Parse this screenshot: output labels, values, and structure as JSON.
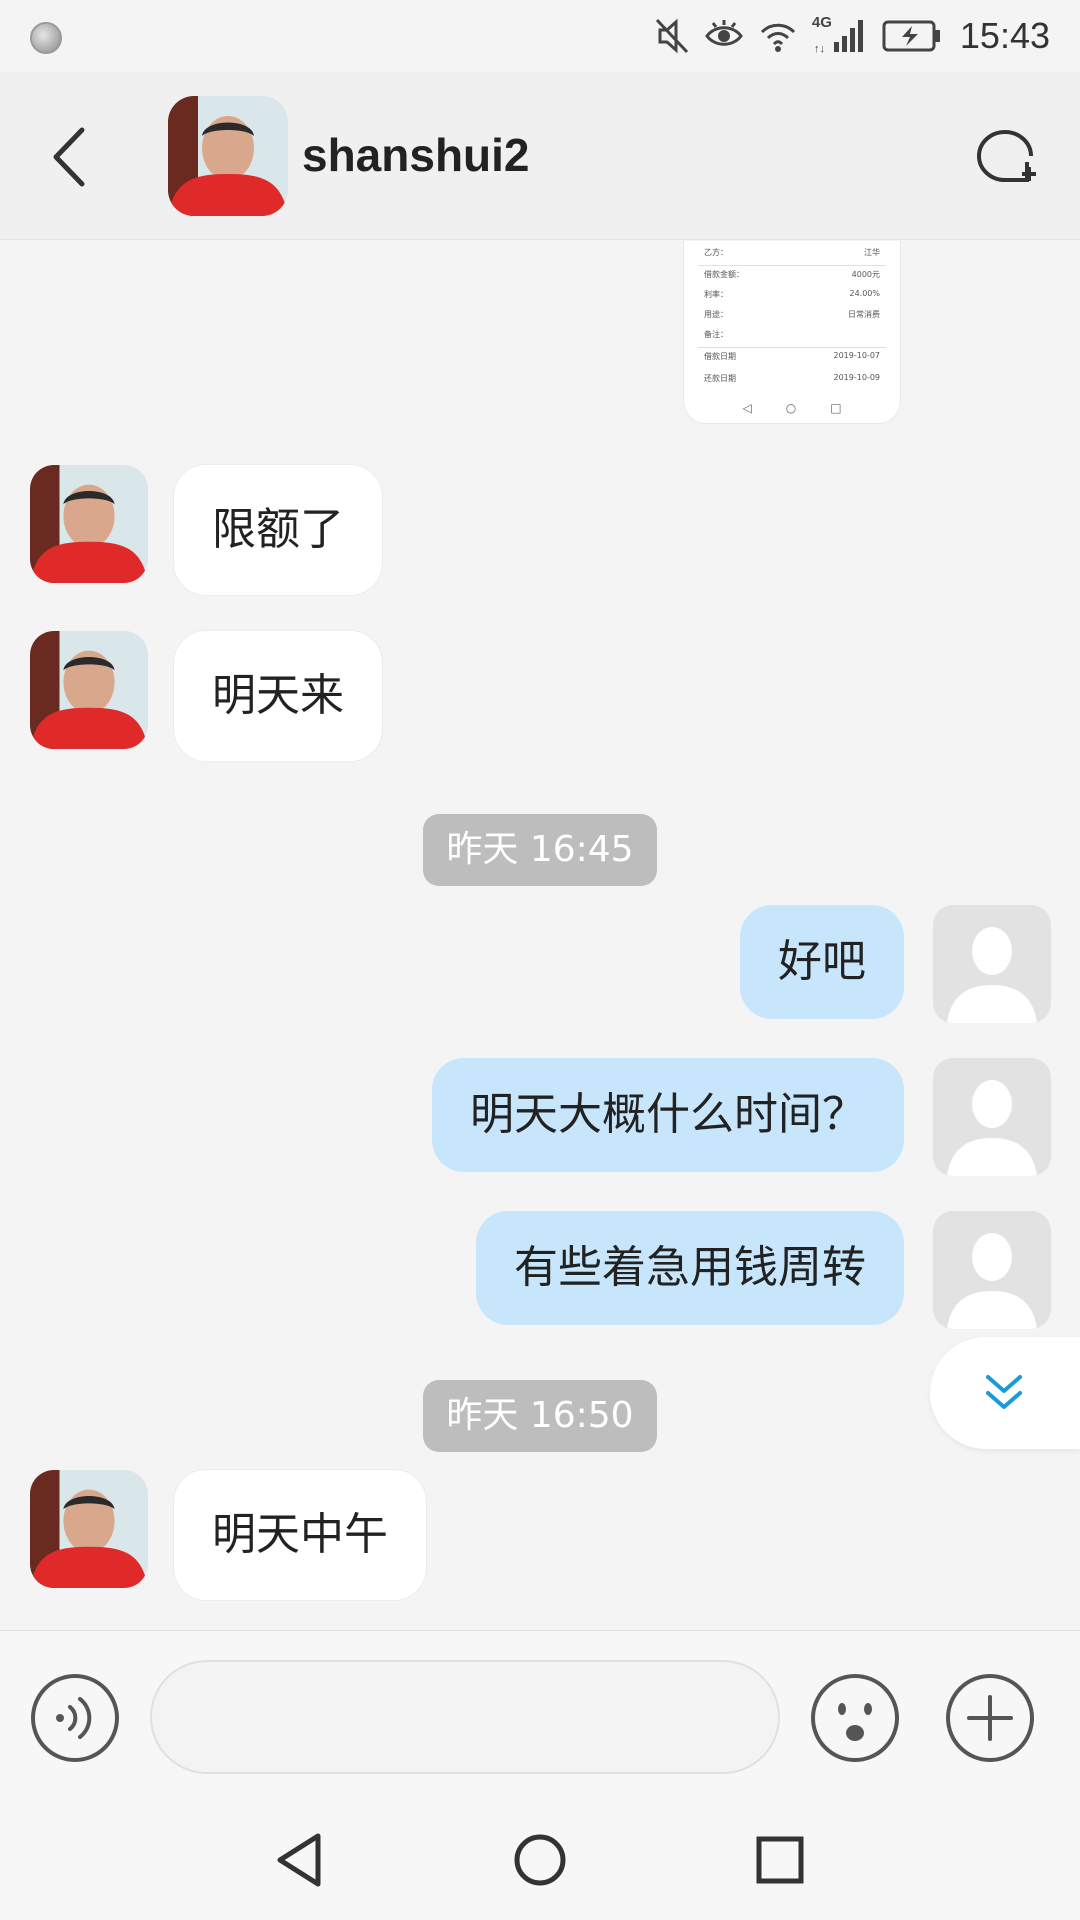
{
  "status_bar": {
    "time": "15:43",
    "network_label": "4G",
    "icons": [
      "notification-app-icon",
      "mute-icon",
      "eye-comfort-icon",
      "wifi-icon",
      "signal-icon",
      "battery-charging-icon"
    ]
  },
  "header": {
    "title": "shanshui2",
    "back_icon": "chevron-left-icon",
    "action_icon": "new-chat-icon"
  },
  "screenshot_message": {
    "rows": [
      {
        "label": "乙方：",
        "value": "江华"
      },
      {
        "label": "借款金额：",
        "value": "4000元"
      },
      {
        "label": "利率：",
        "value": "24.00%"
      },
      {
        "label": "用途：",
        "value": "日常消费"
      },
      {
        "label": "备注：",
        "value": ""
      },
      {
        "label": "借款日期",
        "value": "2019-10-07"
      },
      {
        "label": "还款日期",
        "value": "2019-10-09"
      }
    ],
    "nav_glyphs": [
      "◁",
      "○",
      "□"
    ]
  },
  "messages": [
    {
      "side": "left",
      "text": "限额了"
    },
    {
      "side": "left",
      "text": "明天来"
    },
    {
      "type": "time",
      "text": "昨天 16:45"
    },
    {
      "side": "right",
      "text": "好吧"
    },
    {
      "side": "right",
      "text": "明天大概什么时间？"
    },
    {
      "side": "right",
      "text": "有些着急用钱周转"
    },
    {
      "type": "time",
      "text": "昨天 16:50"
    },
    {
      "side": "left",
      "text": "明天中午"
    }
  ],
  "input": {
    "value": "",
    "placeholder": ""
  },
  "colors": {
    "background": "#f4f4f4",
    "incoming_bubble": "#ffffff",
    "outgoing_bubble": "#c7e6fb",
    "time_pill": "#bdbdbd",
    "accent": "#1a9bd8"
  }
}
